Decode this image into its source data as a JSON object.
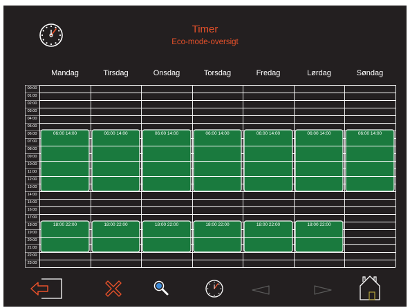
{
  "header": {
    "title": "Timer",
    "subtitle": "Eco-mode-oversigt",
    "clock_icon": "clock-icon"
  },
  "days": [
    "Mandag",
    "Tirsdag",
    "Onsdag",
    "Torsdag",
    "Fredag",
    "Lørdag",
    "Søndag"
  ],
  "hours": [
    "00:00",
    "01:00",
    "02:00",
    "03:00",
    "04:00",
    "05:00",
    "06:00",
    "07:00",
    "08:00",
    "09:00",
    "10:00",
    "11:00",
    "12:00",
    "13:00",
    "14:00",
    "15:00",
    "16:00",
    "17:00",
    "18:00",
    "19:00",
    "20:00",
    "21:00",
    "22:00",
    "23:00"
  ],
  "schedule": [
    [
      {
        "start": 6,
        "end": 14,
        "label": "06:00 14:00"
      },
      {
        "start": 18,
        "end": 22,
        "label": "18:00 22:00"
      }
    ],
    [
      {
        "start": 6,
        "end": 14,
        "label": "06:00 14:00"
      },
      {
        "start": 18,
        "end": 22,
        "label": "18:00 22:00"
      }
    ],
    [
      {
        "start": 6,
        "end": 14,
        "label": "06:00 14:00"
      },
      {
        "start": 18,
        "end": 22,
        "label": "18:00 22:00"
      }
    ],
    [
      {
        "start": 6,
        "end": 14,
        "label": "06:00 14:00"
      },
      {
        "start": 18,
        "end": 22,
        "label": "18:00 22:00"
      }
    ],
    [
      {
        "start": 6,
        "end": 14,
        "label": "06:00 14:00"
      },
      {
        "start": 18,
        "end": 22,
        "label": "18:00 22:00"
      }
    ],
    [
      {
        "start": 6,
        "end": 14,
        "label": "06:00 14:00"
      },
      {
        "start": 18,
        "end": 22,
        "label": "18:00 22:00"
      }
    ],
    [
      {
        "start": 6,
        "end": 14,
        "label": "06:00 14:00"
      }
    ]
  ],
  "toolbar": [
    "exit-icon",
    "delete-icon",
    "search-icon",
    "timer-icon",
    "prev-icon",
    "next-icon",
    "home-icon"
  ],
  "colors": {
    "background": "#231f20",
    "accent": "#e8512a",
    "block": "#1a7a3e",
    "grid": "#ffffff",
    "disabled": "#5a5a5a",
    "home_door": "#b5a33a"
  }
}
